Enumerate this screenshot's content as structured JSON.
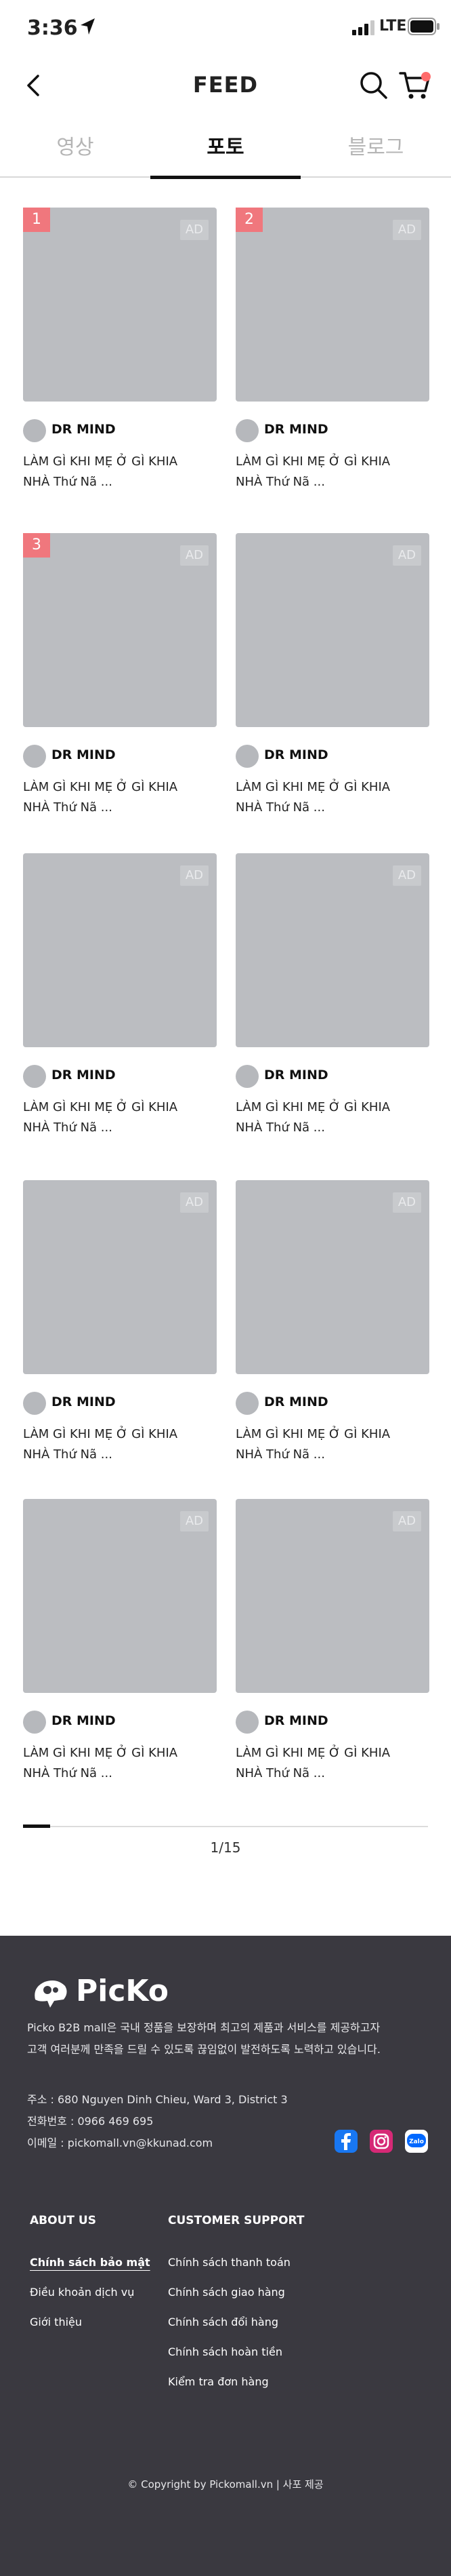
{
  "status_bar": {
    "time": "3:36",
    "network": "LTE",
    "location_icon": "location-arrow-icon",
    "signal_icon": "signal-bars-icon",
    "battery_icon": "battery-icon"
  },
  "header": {
    "title": "FEED",
    "back_icon": "chevron-left-icon",
    "search_icon": "search-icon",
    "cart_icon": "cart-icon"
  },
  "tabs": [
    {
      "label": "영상",
      "active": false
    },
    {
      "label": "포토",
      "active": true
    },
    {
      "label": "블로그",
      "active": false
    }
  ],
  "feed": {
    "ad_label": "AD",
    "items": [
      {
        "rank": "1",
        "author": "DR MIND",
        "desc_line1": "LÀM GÌ KHI MẸ Ở GÌ KHIA",
        "desc_line2": "NHÀ Thứ Nã ..."
      },
      {
        "rank": "2",
        "author": "DR MIND",
        "desc_line1": "LÀM GÌ KHI MẸ Ở GÌ KHIA",
        "desc_line2": "NHÀ Thứ Nã ..."
      },
      {
        "rank": "3",
        "author": "DR MIND",
        "desc_line1": "LÀM GÌ KHI MẸ Ở GÌ KHIA",
        "desc_line2": "NHÀ Thứ Nã ..."
      },
      {
        "rank": "",
        "author": "DR MIND",
        "desc_line1": "LÀM GÌ KHI MẸ Ở GÌ KHIA",
        "desc_line2": "NHÀ Thứ Nã ..."
      },
      {
        "rank": "",
        "author": "DR MIND",
        "desc_line1": "LÀM GÌ KHI MẸ Ở GÌ KHIA",
        "desc_line2": "NHÀ Thứ Nã ..."
      },
      {
        "rank": "",
        "author": "DR MIND",
        "desc_line1": "LÀM GÌ KHI MẸ Ở GÌ KHIA",
        "desc_line2": "NHÀ Thứ Nã ..."
      },
      {
        "rank": "",
        "author": "DR MIND",
        "desc_line1": "LÀM GÌ KHI MẸ Ở GÌ KHIA",
        "desc_line2": "NHÀ Thứ Nã ..."
      },
      {
        "rank": "",
        "author": "DR MIND",
        "desc_line1": "LÀM GÌ KHI MẸ Ở GÌ KHIA",
        "desc_line2": "NHÀ Thứ Nã ..."
      },
      {
        "rank": "",
        "author": "DR MIND",
        "desc_line1": "LÀM GÌ KHI MẸ Ở GÌ KHIA",
        "desc_line2": "NHÀ Thứ Nã ..."
      },
      {
        "rank": "",
        "author": "DR MIND",
        "desc_line1": "LÀM GÌ KHI MẸ Ở GÌ KHIA",
        "desc_line2": "NHÀ Thứ Nã ..."
      }
    ]
  },
  "pager": {
    "text": "1/15",
    "progress": 0.0667
  },
  "footer": {
    "logo_text": "PicKo",
    "intro_line1": "Picko B2B mall은 국내 정품을 보장하며 최고의 제품과 서비스를 제공하고자",
    "intro_line2": "고객 여러분께 만족을 드릴 수 있도록 끊임없이 발전하도록 노력하고 있습니다.",
    "address": "주소 : 680 Nguyen Dinh Chieu, Ward 3, District 3",
    "phone": "전화번호 : 0966 469 695",
    "email": "이메일 : pickomall.vn@kkunad.com",
    "socials": [
      "facebook-icon",
      "instagram-icon",
      "zalo-icon"
    ],
    "zalo_text": "Zalo",
    "about_title": "ABOUT US",
    "about_links": [
      "Chính sách bảo mật",
      "Điều khoản dịch vụ",
      "Giới thiệu"
    ],
    "support_title": "CUSTOMER SUPPORT",
    "support_links": [
      "Chính sách thanh toán",
      "Chính sách giao hàng",
      "Chính sách đổi hàng",
      "Chính sách hoàn tiền",
      "Kiểm tra đơn hàng"
    ],
    "copyright": "© Copyright by Pickomall.vn | 사포 제공",
    "colors": {
      "background": "#3a3940",
      "facebook": "#1877f2",
      "instagram": "#d62976",
      "zalo": "#0068ff"
    }
  },
  "colors": {
    "rank_badge": "#f0777d",
    "placeholder": "#bbbdc1",
    "cart_badge": "#ff6b6b"
  }
}
